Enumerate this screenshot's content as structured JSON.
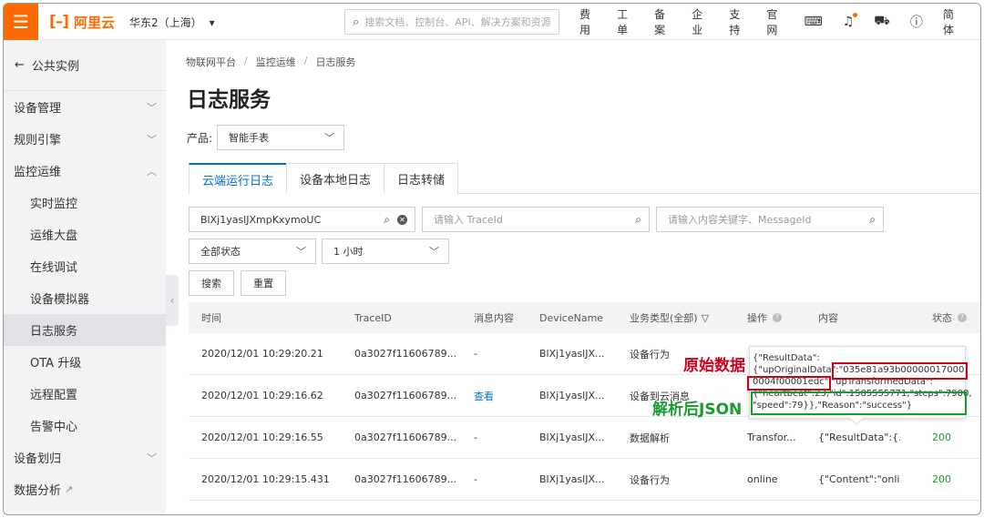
{
  "topbar": {
    "logo_text": "阿里云",
    "region": "华东2（上海）",
    "search_placeholder": "搜索文档、控制台、API、解决方案和资源",
    "nav": [
      "费用",
      "工单",
      "备案",
      "企业",
      "支持",
      "官网"
    ],
    "lang": "简体",
    "brand_color": "#ff6a00"
  },
  "sidebar": {
    "back_label": "公共实例",
    "items": [
      {
        "label": "设备管理"
      },
      {
        "label": "规则引擎"
      },
      {
        "label": "监控运维"
      },
      {
        "label": "实时监控"
      },
      {
        "label": "运维大盘"
      },
      {
        "label": "在线调试"
      },
      {
        "label": "设备模拟器"
      },
      {
        "label": "日志服务"
      },
      {
        "label": "OTA 升级"
      },
      {
        "label": "远程配置"
      },
      {
        "label": "告警中心"
      },
      {
        "label": "设备划归"
      },
      {
        "label": "数据分析"
      }
    ]
  },
  "main": {
    "breadcrumb": [
      "物联网平台",
      "监控运维",
      "日志服务"
    ],
    "title": "日志服务",
    "product_label": "产品:",
    "product_value": "智能手表",
    "tabs": [
      "云端运行日志",
      "设备本地日志",
      "日志转储"
    ],
    "filters": {
      "device_value": "BlXj1yaslJXmpKxymoUC",
      "traceid_placeholder": "请输入 TraceId",
      "keyword_placeholder": "请输入内容关键字、MessageId",
      "status_value": "全部状态",
      "time_value": "1 小时"
    },
    "buttons": {
      "search": "搜索",
      "reset": "重置"
    },
    "table": {
      "headers": [
        "时间",
        "TraceID",
        "消息内容",
        "DeviceName",
        "业务类型(全部)",
        "操作",
        "内容",
        "状态"
      ],
      "rows": [
        {
          "time": "2020/12/01 10:29:20.21",
          "trace": "0a3027f11606789...",
          "msg": "-",
          "device": "BlXj1yaslJX...",
          "biz": "设备行为",
          "op": "",
          "content": "",
          "status": ""
        },
        {
          "time": "2020/12/01 10:29:16.62",
          "trace": "0a3027f11606789...",
          "msg": "查看",
          "device": "BlXj1yaslJX...",
          "biz": "设备到云消息",
          "op": "",
          "content": "",
          "status": ""
        },
        {
          "time": "2020/12/01 10:29:16.55",
          "trace": "0a3027f11606789...",
          "msg": "-",
          "device": "BlXj1yaslJX...",
          "biz": "数据解析",
          "op": "Transfor...",
          "content": "{\"ResultData\":{...",
          "status": "200"
        },
        {
          "time": "2020/12/01 10:29:15.431",
          "trace": "0a3027f11606789...",
          "msg": "-",
          "device": "BlXj1yaslJX...",
          "biz": "设备行为",
          "op": "online",
          "content": "{\"Content\":\"onli...",
          "status": "200"
        }
      ]
    }
  },
  "popover": {
    "lines": [
      "{\"ResultData\":",
      "{\"upOriginalData\":\"035e81a93b00000017000",
      "0004f00001edc\",\"upTransformedData\":",
      "{\"heartbeat\":23,\"id\":1585555771,\"steps\":7900,",
      "\"speed\":79}},\"Reason\":\"success\"}"
    ],
    "annotation_original": "原始数据",
    "annotation_parsed": "解析后JSON",
    "red": "#d0021b",
    "green": "#1a9a30"
  }
}
